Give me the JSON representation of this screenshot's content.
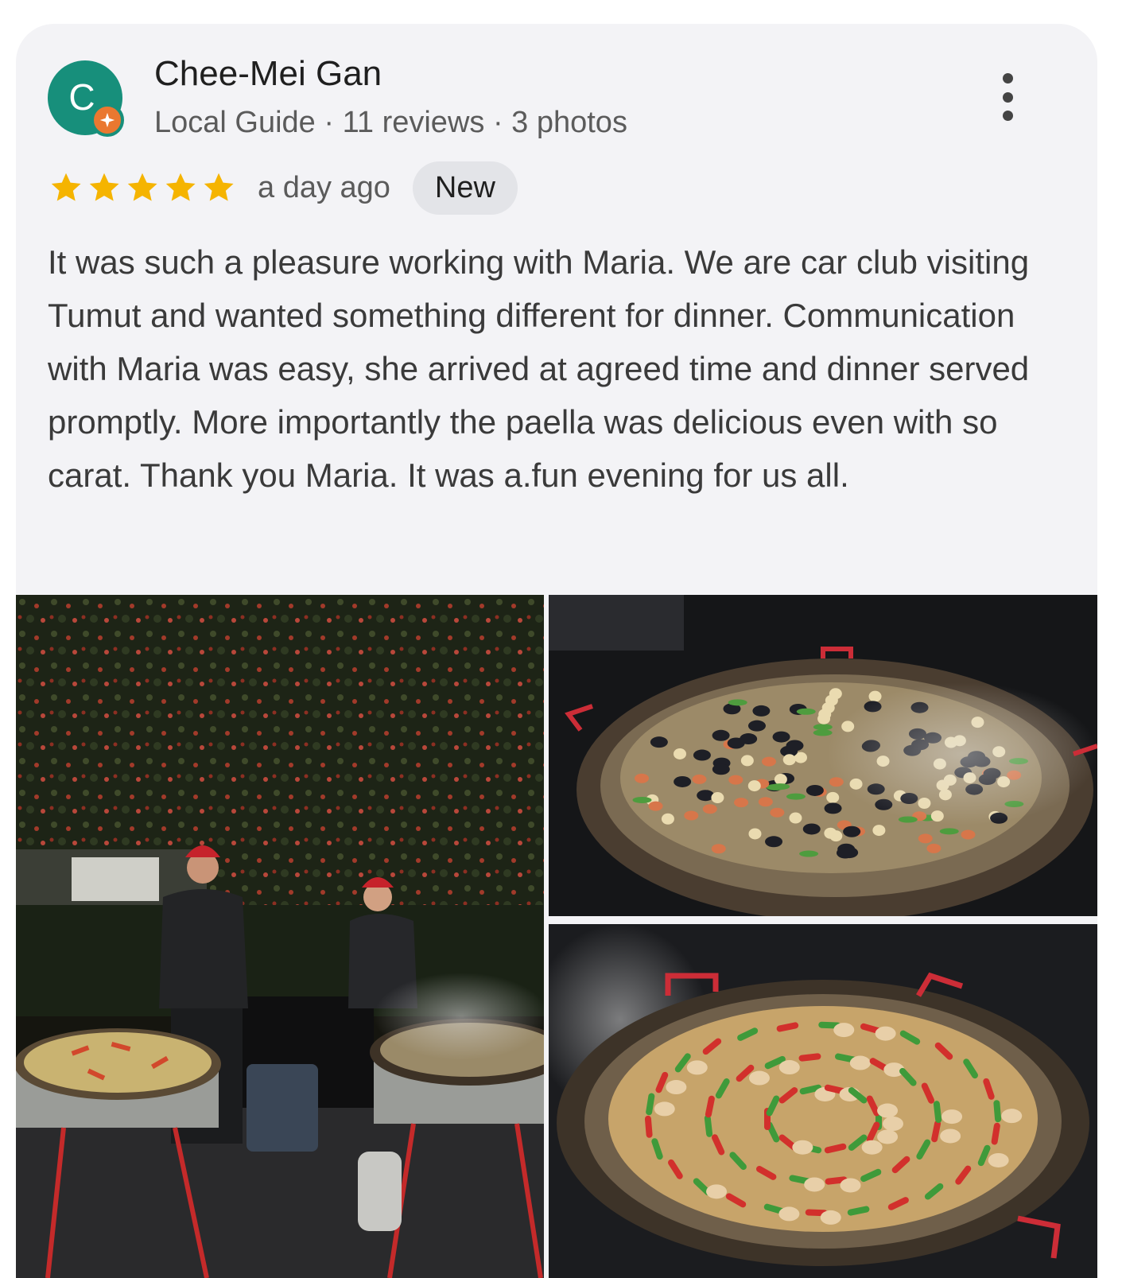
{
  "review": {
    "author": {
      "avatar_letter": "C",
      "avatar_color": "#178f7b",
      "badge_icon": "local-guide-star-icon",
      "badge_color": "#ea7830",
      "name": "Chee-Mei Gan",
      "meta": "Local Guide · 11 reviews · 3 photos"
    },
    "rating": 5,
    "star_color": "#f5b400",
    "time": "a day ago",
    "badge": "New",
    "text": "It was such a pleasure working with Maria. We are car club visiting Tumut and wanted something different for dinner. Communication with Maria was easy, she arrived at agreed time and dinner served promptly. More importantly the paella was delicious even with so carat. Thank you Maria. It was a.fun evening for us all.",
    "menu_icon": "more-vert-icon",
    "photos": [
      {
        "name": "photo-chefs-with-paella-pans"
      },
      {
        "name": "photo-seafood-paella"
      },
      {
        "name": "photo-chicken-paella"
      }
    ]
  }
}
